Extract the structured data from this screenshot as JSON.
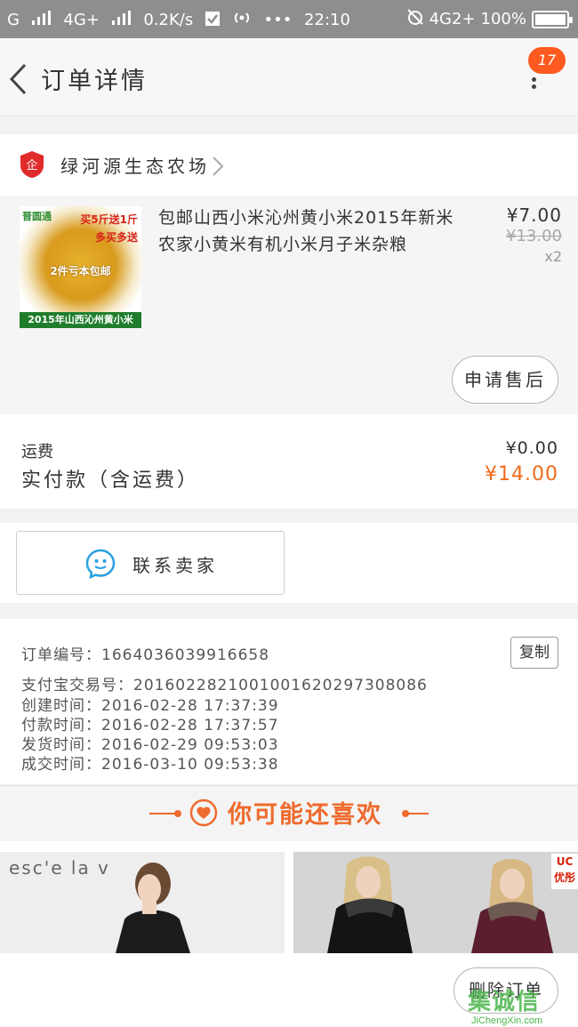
{
  "status_bar": {
    "carrier": "G",
    "network1": "4G+",
    "speed": "0.2K/s",
    "more": "•••",
    "time": "22:10",
    "network2": "4G2+",
    "battery": "100%"
  },
  "nav": {
    "title": "订单详情",
    "badge": "17"
  },
  "shop": {
    "name": "绿河源生态农场"
  },
  "item": {
    "image": {
      "logo": "晋圆通",
      "promo1": "买5斤送1斤",
      "promo2": "多买多送",
      "mid": "2件亏本包邮",
      "band": "2015年山西沁州黄小米"
    },
    "title": "包邮山西小米沁州黄小米2015年新米农家小黄米有机小米月子米杂粮",
    "price": "¥7.00",
    "original_price": "¥13.00",
    "quantity": "x2",
    "after_sale_label": "申请售后"
  },
  "totals": {
    "shipping_label": "运费",
    "shipping_value": "¥0.00",
    "paid_label": "实付款（含运费）",
    "paid_value": "¥14.00"
  },
  "contact": {
    "label": "联系卖家"
  },
  "order_info": {
    "order_no": "订单编号：1664036039916658",
    "alipay_no": "支付宝交易号：2016022821001001620297308086",
    "created": "创建时间：2016-02-28 17:37:39",
    "paid": "付款时间：2016-02-28 17:37:57",
    "shipped": "发货时间：2016-02-29 09:53:03",
    "completed": "成交时间：2016-03-10 09:53:38",
    "copy_label": "复制"
  },
  "recommend": {
    "title": "你可能还喜欢",
    "products": [
      {
        "brand": "esc'e la v"
      },
      {
        "tag": "UC优彤"
      }
    ]
  },
  "bottom": {
    "delete_label": "删除订单",
    "watermark_logo": "集诚信",
    "watermark_url": "JiChengXin.com"
  },
  "colors": {
    "accent": "#ee6a2d",
    "status_bar": "#8e8e8e",
    "badge": "#ff5a1f"
  }
}
